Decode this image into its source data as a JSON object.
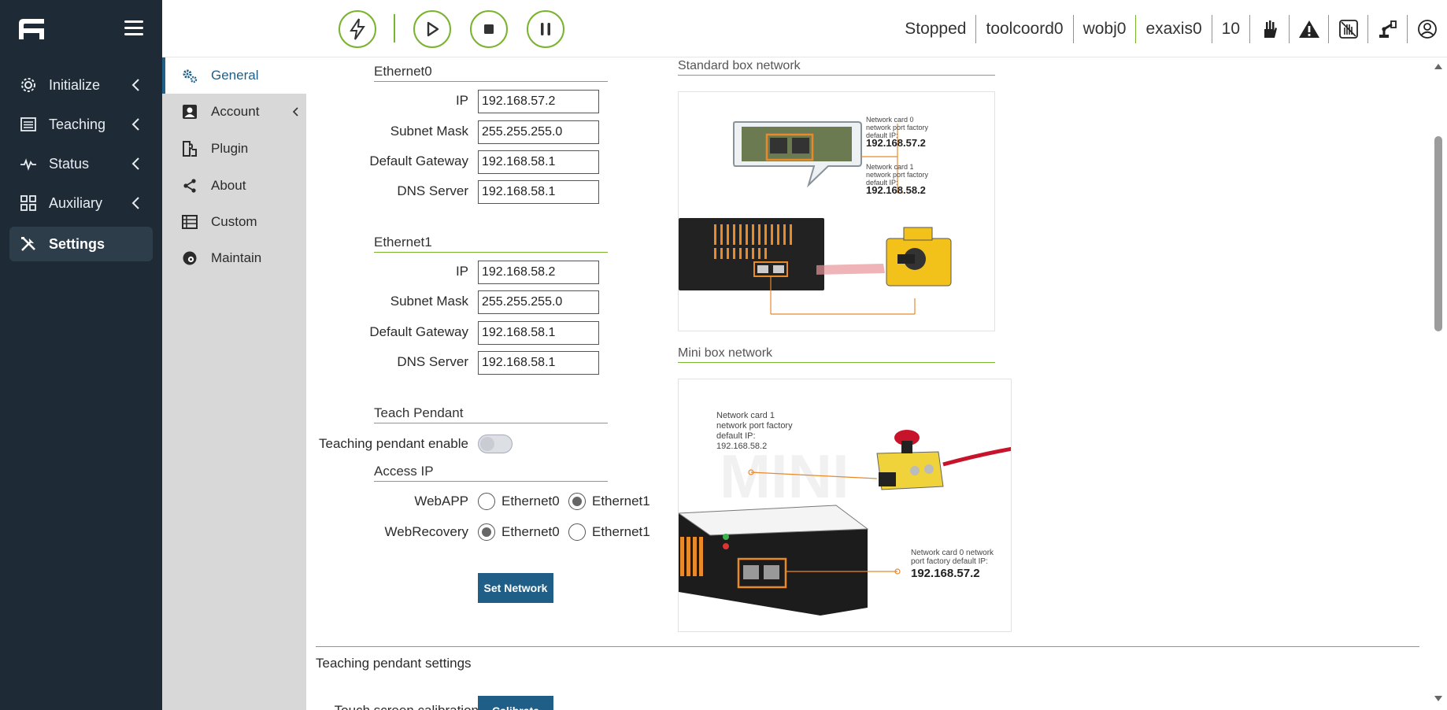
{
  "nav": {
    "items": [
      {
        "label": "Initialize",
        "icon": "gear-icon"
      },
      {
        "label": "Teaching",
        "icon": "list-icon"
      },
      {
        "label": "Status",
        "icon": "pulse-icon"
      },
      {
        "label": "Auxiliary",
        "icon": "grid-icon"
      },
      {
        "label": "Settings",
        "icon": "tools-icon"
      }
    ]
  },
  "subnav": {
    "items": [
      {
        "label": "General"
      },
      {
        "label": "Account"
      },
      {
        "label": "Plugin"
      },
      {
        "label": "About"
      },
      {
        "label": "Custom"
      },
      {
        "label": "Maintain"
      }
    ]
  },
  "topbar": {
    "status": "Stopped",
    "toolcoord": "toolcoord0",
    "wobj": "wobj0",
    "exaxis": "exaxis0",
    "speed": "10"
  },
  "network": {
    "eth0": {
      "title": "Ethernet0",
      "ip_label": "IP",
      "ip": "192.168.57.2",
      "mask_label": "Subnet Mask",
      "mask": "255.255.255.0",
      "gw_label": "Default Gateway",
      "gw": "192.168.58.1",
      "dns_label": "DNS Server",
      "dns": "192.168.58.1"
    },
    "eth1": {
      "title": "Ethernet1",
      "ip_label": "IP",
      "ip": "192.168.58.2",
      "mask_label": "Subnet Mask",
      "mask": "255.255.255.0",
      "gw_label": "Default Gateway",
      "gw": "192.168.58.1",
      "dns_label": "DNS Server",
      "dns": "192.168.58.1"
    },
    "teach_pendant": {
      "title": "Teach Pendant",
      "enable_label": "Teaching pendant enable"
    },
    "access_ip": {
      "title": "Access IP",
      "webapp_label": "WebAPP",
      "webrecovery_label": "WebRecovery",
      "opt0": "Ethernet0",
      "opt1": "Ethernet1",
      "webapp_selected": "Ethernet1",
      "webrecovery_selected": "Ethernet0"
    },
    "set_button": "Set Network"
  },
  "diagrams": {
    "standard_title": "Standard box network",
    "standard_card0_text": "Network card 0 network port factory default IP:",
    "standard_card0_ip": "192.168.57.2",
    "standard_card1_text": "Network card 1 network port factory default IP:",
    "standard_card1_ip": "192.168.58.2",
    "mini_title": "Mini box network",
    "mini_card1_text": "Network card 1 network port factory default IP:",
    "mini_card1_ip": "192.168.58.2",
    "mini_card0_text": "Network card 0 network port factory default IP:",
    "mini_card0_ip": "192.168.57.2"
  },
  "pendant_settings": {
    "title": "Teaching pendant settings",
    "touch_label": "Touch screen calibration",
    "calibrate_button": "Calibrate"
  },
  "colors": {
    "nav_bg": "#1e2b36",
    "accent_green": "#7ab32e",
    "primary_blue": "#1f5f87",
    "subnav_bg": "#d8d8d8"
  }
}
